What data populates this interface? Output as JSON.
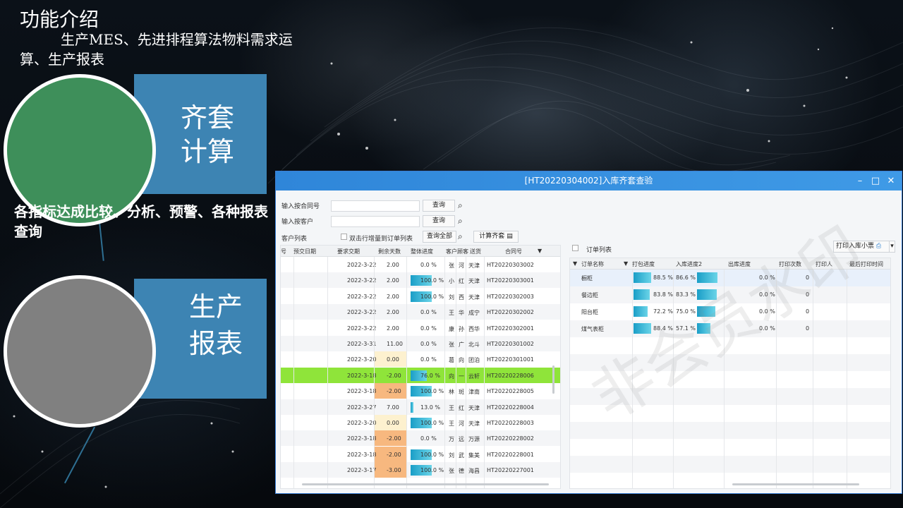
{
  "slide": {
    "title": "功能介绍",
    "desc": "生产MES、先进排程算法物料需求运算、生产报表",
    "card1_label": "齐套计算",
    "card2_label": "生产报表",
    "mid_text": "各指标达成比较、分析、预警、各种报表查询",
    "circle1_color": "#3e8f5a",
    "circle2_color": "#808080",
    "card_color": "#3d84b3"
  },
  "window": {
    "title": "[HT20220304002]入库齐套查验",
    "min_icon": "minimize-icon",
    "max_icon": "maximize-icon",
    "close_icon": "close-icon"
  },
  "form": {
    "contract_label": "输入按合同号",
    "customer_label": "输入按客户",
    "query_label": "查询",
    "customer_list_label": "客户列表",
    "dblclick_label": "双击行增量到订单列表",
    "query_all_label": "查询全部",
    "calc_label": "计算齐套",
    "order_list_label": "订单列表",
    "print_ticket_label": "打印入库小票"
  },
  "left_table": {
    "headers": [
      "号",
      "预交日期",
      "要求交期",
      "剩余天数",
      "整体进度",
      "客户",
      "顾客",
      "送货",
      "合同号"
    ],
    "rows": [
      {
        "date": "2022-3-22",
        "days": "2.00",
        "progress": "0.0 %",
        "pct": 0,
        "c1": "张",
        "c2": "河",
        "c3": "天津",
        "contract": "HT20220303002"
      },
      {
        "date": "2022-3-22",
        "days": "2.00",
        "progress": "100.0 %",
        "pct": 1,
        "c1": "小",
        "c2": "红",
        "c3": "天津",
        "contract": "HT20220303001"
      },
      {
        "date": "2022-3-22",
        "days": "2.00",
        "progress": "100.0 %",
        "pct": 1,
        "c1": "刘",
        "c2": "西",
        "c3": "天津",
        "contract": "HT20220302003"
      },
      {
        "date": "2022-3-22",
        "days": "2.00",
        "progress": "0.0 %",
        "pct": 0,
        "c1": "王",
        "c2": "华",
        "c3": "成宁",
        "contract": "HT20220302002"
      },
      {
        "date": "2022-3-22",
        "days": "2.00",
        "progress": "0.0 %",
        "pct": 0,
        "c1": "康",
        "c2": "孙",
        "c3": "西华",
        "contract": "HT20220302001"
      },
      {
        "date": "2022-3-31",
        "days": "11.00",
        "progress": "0.0 %",
        "pct": 0,
        "c1": "张",
        "c2": "广",
        "c3": "北斗",
        "contract": "HT20220301002"
      },
      {
        "date": "2022-3-20",
        "days": "0.00",
        "progress": "0.0 %",
        "pct": 0,
        "c1": "葛",
        "c2": "向",
        "c3": "团泊",
        "contract": "HT20220301001"
      },
      {
        "date": "2022-3-18",
        "days": "-2.00",
        "progress": "76.0 %",
        "pct": 0.76,
        "c1": "向",
        "c2": "一",
        "c3": "云轩",
        "contract": "HT20220228006"
      },
      {
        "date": "2022-3-18",
        "days": "-2.00",
        "progress": "100.0 %",
        "pct": 1,
        "c1": "林",
        "c2": "斑",
        "c3": "津南",
        "contract": "HT20220228005"
      },
      {
        "date": "2022-3-27",
        "days": "7.00",
        "progress": "13.0 %",
        "pct": 0.13,
        "c1": "王",
        "c2": "红",
        "c3": "天津",
        "contract": "HT20220228004"
      },
      {
        "date": "2022-3-20",
        "days": "0.00",
        "progress": "100.0 %",
        "pct": 1,
        "c1": "王",
        "c2": "河",
        "c3": "天津",
        "contract": "HT20220228003"
      },
      {
        "date": "2022-3-18",
        "days": "-2.00",
        "progress": "0.0 %",
        "pct": 0,
        "c1": "万",
        "c2": "远",
        "c3": "万源",
        "contract": "HT20220228002"
      },
      {
        "date": "2022-3-18",
        "days": "-2.00",
        "progress": "100.0 %",
        "pct": 1,
        "c1": "刘",
        "c2": "武",
        "c3": "集美",
        "contract": "HT20220228001"
      },
      {
        "date": "2022-3-17",
        "days": "-3.00",
        "progress": "100.0 %",
        "pct": 1,
        "c1": "张",
        "c2": "德",
        "c3": "海昌",
        "contract": "HT20220227001"
      }
    ]
  },
  "right_table": {
    "headers": [
      "订单名称",
      "打包进度",
      "入库进度2",
      "出库进度",
      "打印次数",
      "打印人",
      "最后打印时间"
    ],
    "rows": [
      {
        "name": "橱柜",
        "pack": "88.5 %",
        "pack_pct": 0.885,
        "stock": "86.6 %",
        "stock_pct": 0.866,
        "out": "0.0 %",
        "count": "0"
      },
      {
        "name": "餐边柜",
        "pack": "83.8 %",
        "pack_pct": 0.838,
        "stock": "83.3 %",
        "stock_pct": 0.833,
        "out": "0.0 %",
        "count": "0"
      },
      {
        "name": "阳台柜",
        "pack": "72.2 %",
        "pack_pct": 0.722,
        "stock": "75.0 %",
        "stock_pct": 0.75,
        "out": "0.0 %",
        "count": "0"
      },
      {
        "name": "煤气表柜",
        "pack": "88.4 %",
        "pack_pct": 0.884,
        "stock": "57.1 %",
        "stock_pct": 0.571,
        "out": "0.0 %",
        "count": "0"
      }
    ]
  },
  "watermark": "非会员水印"
}
